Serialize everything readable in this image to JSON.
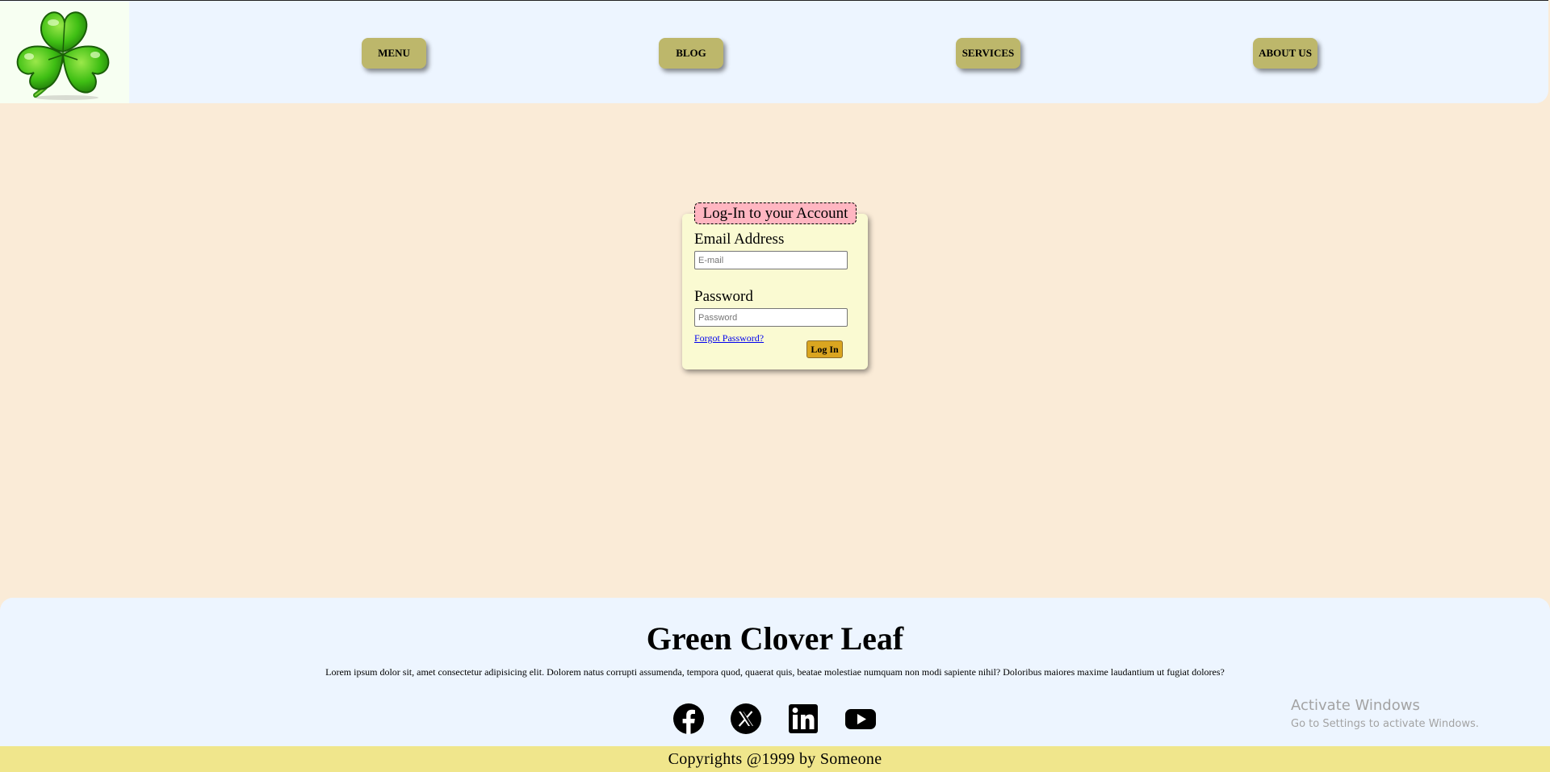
{
  "header": {
    "logo_icon": "four-leaf-clover-icon",
    "nav": [
      "MENU",
      "BLOG",
      "SERVICES",
      "ABOUT US"
    ]
  },
  "login": {
    "legend": "Log-In to your Account",
    "email_label": "Email Address",
    "email_placeholder": "E-mail",
    "password_label": "Password",
    "password_placeholder": "Password",
    "forgot_link": "Forgot Password?",
    "submit_label": "Log In"
  },
  "footer": {
    "title": "Green Clover Leaf",
    "description": "Lorem ipsum dolor sit, amet consectetur adipisicing elit. Dolorem natus corrupti assumenda, tempora quod, quaerat quis, beatae molestiae numquam non modi sapiente nihil? Doloribus maiores maxime laudantium ut fugiat dolores?",
    "social_icons": [
      "facebook-icon",
      "x-icon",
      "linkedin-icon",
      "youtube-icon"
    ],
    "copyright": "Copyrights @1999 by Someone"
  },
  "os_overlay": {
    "line1": "Activate Windows",
    "line2": "Go to Settings to activate Windows."
  },
  "colors": {
    "page_bg": "#faebd7",
    "header_bg": "#edf5ff",
    "nav_button": "#bdb76b",
    "card_bg": "#fafad2",
    "legend_bg": "#ffb6c1",
    "login_button": "#daa520",
    "bottom_bar": "#f0e68c"
  }
}
